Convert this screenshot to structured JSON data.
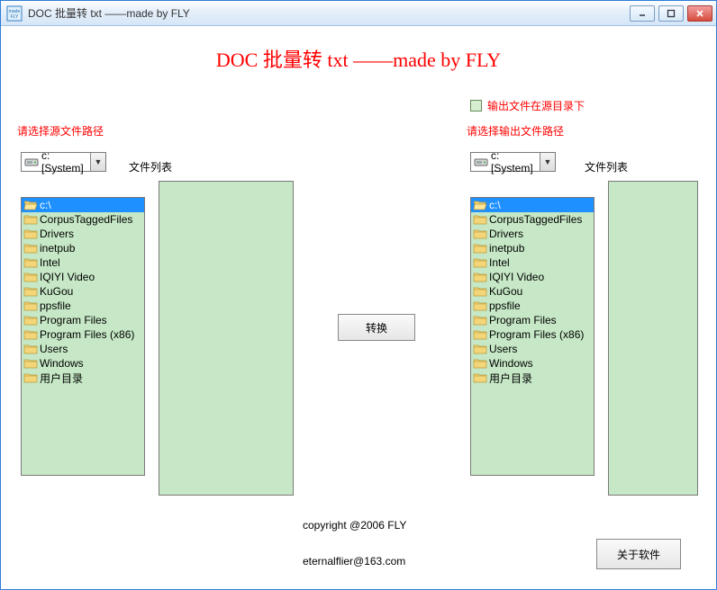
{
  "window": {
    "title": "DOC 批量转 txt ——made by FLY"
  },
  "header": {
    "main_title": "DOC 批量转 txt ——made by FLY"
  },
  "output_same_dir": {
    "label": "输出文件在源目录下",
    "checked": false
  },
  "source": {
    "path_label": "请选择源文件路径",
    "drive": "c: [System]",
    "filelist_label": "文件列表",
    "folders": [
      {
        "label": "c:\\",
        "type": "open",
        "selected": true
      },
      {
        "label": "CorpusTaggedFiles",
        "type": "closed"
      },
      {
        "label": "Drivers",
        "type": "closed"
      },
      {
        "label": "inetpub",
        "type": "closed"
      },
      {
        "label": "Intel",
        "type": "closed"
      },
      {
        "label": "IQIYI Video",
        "type": "closed"
      },
      {
        "label": "KuGou",
        "type": "closed"
      },
      {
        "label": "ppsfile",
        "type": "closed"
      },
      {
        "label": "Program Files",
        "type": "closed"
      },
      {
        "label": "Program Files (x86)",
        "type": "closed"
      },
      {
        "label": "Users",
        "type": "closed"
      },
      {
        "label": "Windows",
        "type": "closed"
      },
      {
        "label": "用户目录",
        "type": "closed"
      }
    ]
  },
  "dest": {
    "path_label": "请选择输出文件路径",
    "drive": "c: [System]",
    "filelist_label": "文件列表",
    "folders": [
      {
        "label": "c:\\",
        "type": "open",
        "selected": true
      },
      {
        "label": "CorpusTaggedFiles",
        "type": "closed"
      },
      {
        "label": "Drivers",
        "type": "closed"
      },
      {
        "label": "inetpub",
        "type": "closed"
      },
      {
        "label": "Intel",
        "type": "closed"
      },
      {
        "label": "IQIYI Video",
        "type": "closed"
      },
      {
        "label": "KuGou",
        "type": "closed"
      },
      {
        "label": "ppsfile",
        "type": "closed"
      },
      {
        "label": "Program Files",
        "type": "closed"
      },
      {
        "label": "Program Files (x86)",
        "type": "closed"
      },
      {
        "label": "Users",
        "type": "closed"
      },
      {
        "label": "Windows",
        "type": "closed"
      },
      {
        "label": "用户目录",
        "type": "closed"
      }
    ]
  },
  "buttons": {
    "convert": "转换",
    "about": "关于软件"
  },
  "footer": {
    "copyright": "copyright @2006 FLY",
    "email": "eternalflier@163.com"
  }
}
